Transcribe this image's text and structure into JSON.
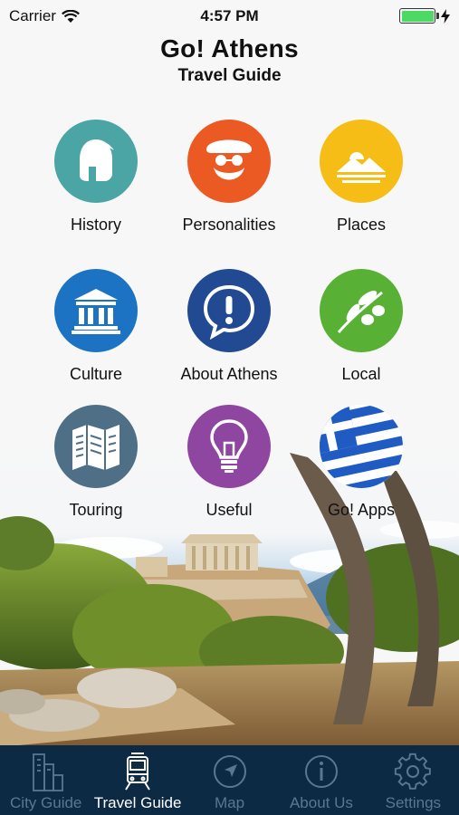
{
  "status_bar": {
    "carrier": "Carrier",
    "time": "4:57 PM",
    "battery_level": 1.0,
    "battery_color": "#4cd964"
  },
  "header": {
    "title": "Go! Athens",
    "subtitle": "Travel Guide"
  },
  "menu": [
    {
      "label": "History",
      "icon": "spartan-helmet-icon",
      "color": "#4aa5a4"
    },
    {
      "label": "Personalities",
      "icon": "bearded-face-icon",
      "color": "#ec5a24"
    },
    {
      "label": "Places",
      "icon": "landscape-icon",
      "color": "#f5bd15"
    },
    {
      "label": "Culture",
      "icon": "temple-icon",
      "color": "#1c73c4"
    },
    {
      "label": "About Athens",
      "icon": "exclamation-bubble-icon",
      "color": "#224a92"
    },
    {
      "label": "Local",
      "icon": "olive-branch-icon",
      "color": "#58b034"
    },
    {
      "label": "Touring",
      "icon": "map-icon",
      "color": "#4e6f86"
    },
    {
      "label": "Useful",
      "icon": "lightbulb-icon",
      "color": "#8e46a0"
    },
    {
      "label": "Go! Apps",
      "icon": "greek-flag-icon",
      "color": "#1f5bc2"
    }
  ],
  "tab_bar": {
    "background": "#0d2a45",
    "active_index": 1,
    "tabs": [
      {
        "label": "City Guide",
        "icon": "buildings-icon"
      },
      {
        "label": "Travel Guide",
        "icon": "tram-icon"
      },
      {
        "label": "Map",
        "icon": "compass-icon"
      },
      {
        "label": "About Us",
        "icon": "info-icon"
      },
      {
        "label": "Settings",
        "icon": "gear-icon"
      }
    ]
  }
}
